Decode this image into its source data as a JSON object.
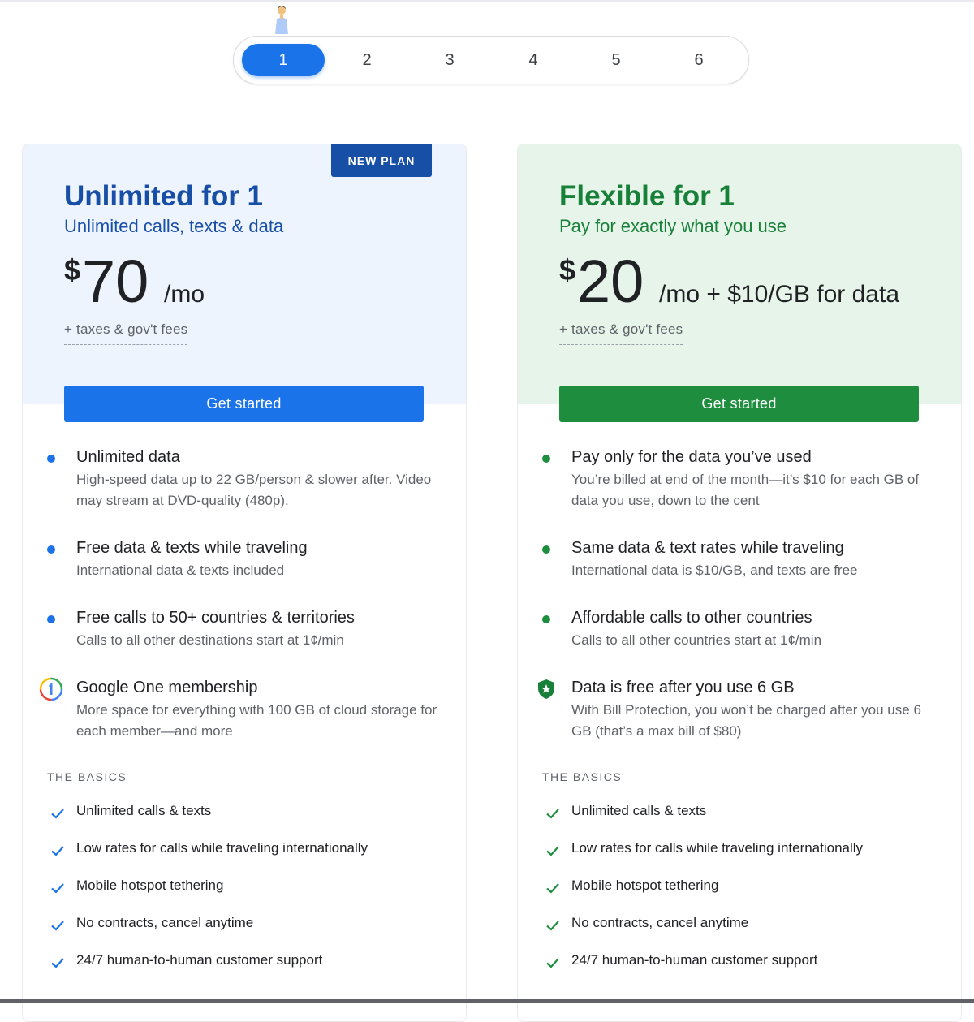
{
  "selector": {
    "options": [
      "1",
      "2",
      "3",
      "4",
      "5",
      "6"
    ],
    "selected": "1"
  },
  "colors": {
    "blue": "#1a73e8",
    "dark_blue": "#174ea6",
    "green": "#1e8e3e",
    "dark_green": "#188038"
  },
  "plans": [
    {
      "badge": "NEW PLAN",
      "title": "Unlimited for 1",
      "subtitle": "Unlimited calls, texts & data",
      "currency": "$",
      "amount": "70",
      "period": "/mo",
      "fees": "+ taxes & gov't fees",
      "cta": "Get started",
      "features": [
        {
          "icon": "bullet-dot",
          "title": "Unlimited data",
          "desc": "High-speed data up to 22 GB/person & slower after. Video may stream at DVD-quality (480p)."
        },
        {
          "icon": "bullet-dot",
          "title": "Free data & texts while traveling",
          "desc": "International data & texts included"
        },
        {
          "icon": "bullet-dot",
          "title": "Free calls to 50+ countries & territories",
          "desc": "Calls to all other destinations start at 1¢/min"
        },
        {
          "icon": "google-one-icon",
          "title": "Google One membership",
          "desc": "More space for everything with 100 GB of cloud storage for each member—and more"
        }
      ],
      "basics_label": "THE BASICS",
      "basics": [
        "Unlimited calls & texts",
        "Low rates for calls while traveling internationally",
        "Mobile hotspot tethering",
        "No contracts, cancel anytime",
        "24/7 human-to-human customer support"
      ]
    },
    {
      "title": "Flexible for 1",
      "subtitle": "Pay for exactly what you use",
      "currency": "$",
      "amount": "20",
      "period": "/mo + $10/GB for data",
      "fees": "+ taxes & gov't fees",
      "cta": "Get started",
      "features": [
        {
          "icon": "bullet-dot",
          "title": "Pay only for the data you’ve used",
          "desc": "You’re billed at end of the month—it’s $10 for each GB of data you use, down to the cent"
        },
        {
          "icon": "bullet-dot",
          "title": "Same data & text rates while traveling",
          "desc": "International data is $10/GB, and texts are free"
        },
        {
          "icon": "bullet-dot",
          "title": "Affordable calls to other countries",
          "desc": "Calls to all other countries start at 1¢/min"
        },
        {
          "icon": "shield-star-icon",
          "title": "Data is free after you use 6 GB",
          "desc": "With Bill Protection, you won’t be charged after you use 6 GB (that’s a max bill of $80)"
        }
      ],
      "basics_label": "THE BASICS",
      "basics": [
        "Unlimited calls & texts",
        "Low rates for calls while traveling internationally",
        "Mobile hotspot tethering",
        "No contracts, cancel anytime",
        "24/7 human-to-human customer support"
      ]
    }
  ]
}
